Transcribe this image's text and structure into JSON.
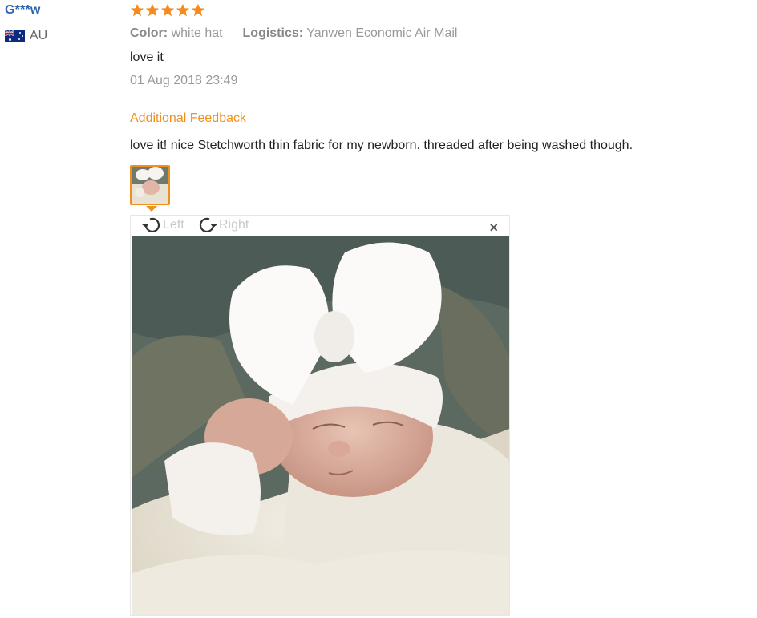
{
  "user": {
    "name": "G***w",
    "country": "AU"
  },
  "rating": {
    "stars": 5,
    "star_color": "#f58a1f"
  },
  "meta": {
    "color_label": "Color:",
    "color_value": "white hat",
    "logistics_label": "Logistics:",
    "logistics_value": "Yanwen Economic Air Mail"
  },
  "review_text": "love it",
  "date": "01 Aug 2018 23:49",
  "additional": {
    "title": "Additional Feedback",
    "text": "love it! nice Stetchworth thin fabric for my newborn. threaded after being washed though."
  },
  "viewer": {
    "rotate_left": "Left",
    "rotate_right": "Right",
    "close": "×"
  },
  "colors": {
    "accent": "#f0901c",
    "username": "#2f64b3"
  }
}
